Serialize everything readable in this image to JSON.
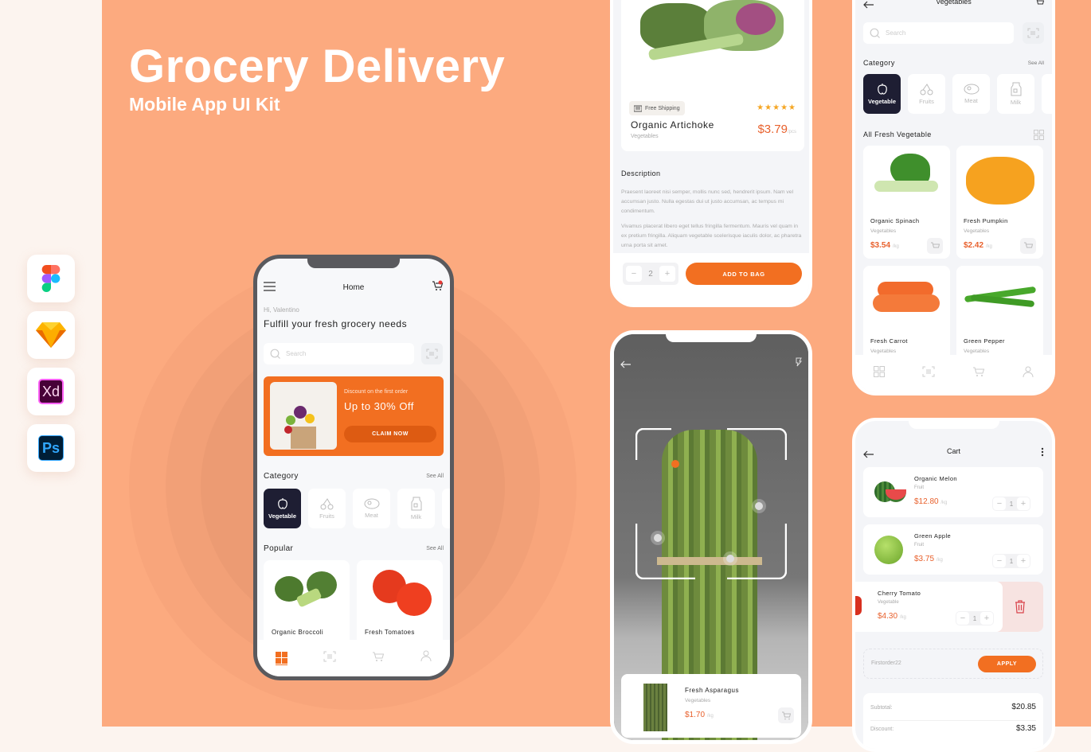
{
  "hero": {
    "title": "Grocery Delivery",
    "subtitle": "Mobile App UI Kit",
    "tools": [
      "figma-logo",
      "sketch-logo",
      "adobe-xd-logo",
      "photoshop-logo"
    ],
    "xd_label": "Xd",
    "ps_label": "Ps"
  },
  "colors": {
    "accent": "#f26f21",
    "dark": "#1e1e33",
    "background": "#fcaa7f"
  },
  "home": {
    "title": "Home",
    "greeting": "Hi, Valentino",
    "headline": "Fulfill your fresh grocery needs",
    "search_placeholder": "Search",
    "promo": {
      "small": "Discount on the first order",
      "big": "Up to 30% Off",
      "button": "CLAIM NOW"
    },
    "category_title": "Category",
    "see_all": "See All",
    "categories": [
      "Vegetable",
      "Fruits",
      "Meat",
      "Milk"
    ],
    "popular_title": "Popular",
    "popular": [
      "Organic Broccoli",
      "Fresh Tomatoes"
    ]
  },
  "detail": {
    "badge": "Free Shipping",
    "rating": 5,
    "stars": "★★★★★",
    "name": "Organic Artichoke",
    "category": "Vegetables",
    "price": "$3.79",
    "unit": "/pcs",
    "description_title": "Description",
    "description_1": "Praesent laoreet nisi semper, mollis nunc sed, hendrerit ipsum. Nam vel accumsan justo. Nulla egestas dui ut justo accumsan, ac tempus mi condimentum.",
    "description_2": "Vivamus placerat libero eget tellus fringilla fermentum. Mauris vel quam in ex pretium fringilla. Aliquam vegetable scelerisque iaculis dolor, ac pharetra urna porta sit amet.",
    "quantity": "2",
    "add_button": "ADD TO BAG"
  },
  "scan": {
    "product": {
      "name": "Fresh Asparagus",
      "category": "Vegetables",
      "price": "$1.70",
      "unit": "/kg"
    }
  },
  "vegetables": {
    "title": "Vegetables",
    "search_placeholder": "Search",
    "category_title": "Category",
    "see_all": "See All",
    "categories": [
      "Vegetable",
      "Fruits",
      "Meat",
      "Milk"
    ],
    "list_title": "All Fresh Vegetable",
    "products": [
      {
        "name": "Organic Spinach",
        "category": "Vegetables",
        "price": "$3.54",
        "unit": "/kg"
      },
      {
        "name": "Fresh Pumpkin",
        "category": "Vegetables",
        "price": "$2.42",
        "unit": "/kg"
      },
      {
        "name": "Fresh Carrot",
        "category": "Vegetables"
      },
      {
        "name": "Green Pepper",
        "category": "Vegetables"
      }
    ]
  },
  "cart": {
    "title": "Cart",
    "items": [
      {
        "name": "Organic Melon",
        "category": "Fruit",
        "price": "$12.80",
        "unit": "/kg",
        "qty": "1"
      },
      {
        "name": "Green Apple",
        "category": "Fruit",
        "price": "$3.75",
        "unit": "/kg",
        "qty": "1"
      },
      {
        "name": "Cherry Tomato",
        "category": "Vegetable",
        "price": "$4.30",
        "unit": "/kg",
        "qty": "1"
      }
    ],
    "promo_code": "Firstorder22",
    "apply_button": "APPLY",
    "subtotal_label": "Subtotal:",
    "subtotal": "$20.85",
    "discount_label": "Discount:",
    "discount": "$3.35"
  }
}
